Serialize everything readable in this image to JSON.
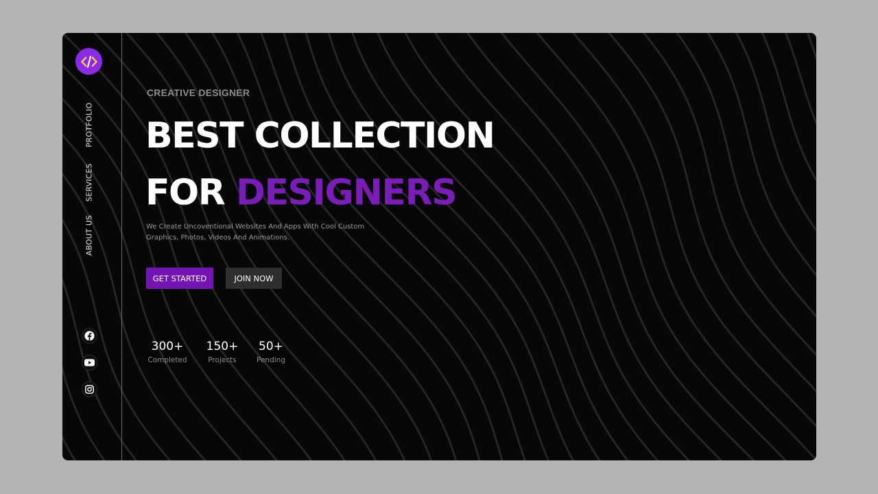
{
  "brand": {
    "logo_icon": "code-icon",
    "accent_color": "#8b2be8"
  },
  "nav": [
    {
      "label": "PROTFOLIO"
    },
    {
      "label": "SERVICES"
    },
    {
      "label": "ABOUT US"
    }
  ],
  "social": [
    {
      "icon": "facebook-icon"
    },
    {
      "icon": "youtube-icon"
    },
    {
      "icon": "instagram-icon"
    }
  ],
  "hero": {
    "eyebrow": "CREATIVE DESIGNER",
    "line1": "BEST COLLECTION",
    "line2_prefix": "FOR ",
    "line2_accent": "DESIGNERS",
    "description": "We Create Uncoventional Websites And Apps With Cool Custom Graphics, Photos, Videos And Animations.",
    "accent_color": "#7a1cb8"
  },
  "buttons": {
    "primary": "GET STARTED",
    "secondary": "JOIN NOW"
  },
  "stats": [
    {
      "value": "300+",
      "label": "Completed"
    },
    {
      "value": "150+",
      "label": "Projects"
    },
    {
      "value": "50+",
      "label": "Pending"
    }
  ]
}
